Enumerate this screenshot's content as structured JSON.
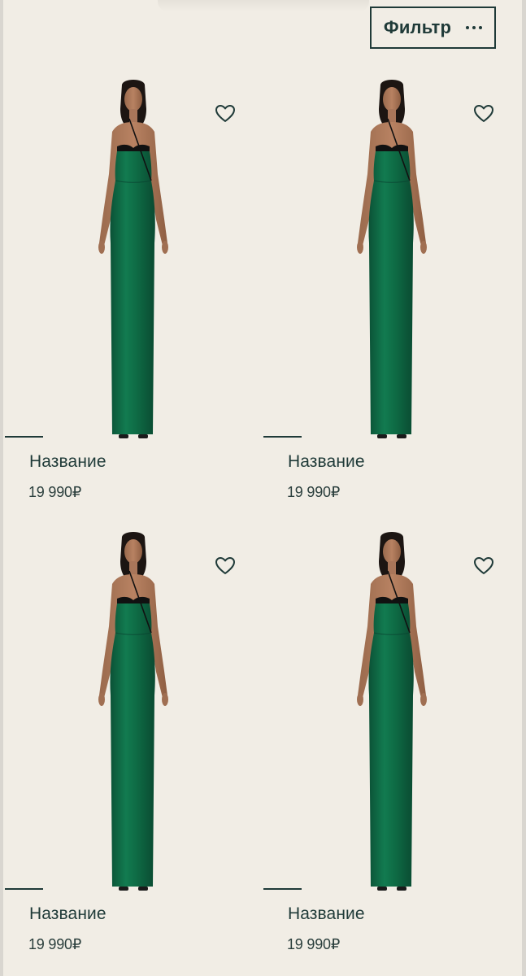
{
  "header": {
    "filter_label": "Фильтр",
    "more_icon": "more-dots-icon"
  },
  "colors": {
    "background": "#f1ede5",
    "accent": "#1f3a38",
    "dress": "#0f6b45"
  },
  "products": [
    {
      "name": "Название",
      "price": "19 990₽",
      "favorite_icon": "heart-outline-icon"
    },
    {
      "name": "Название",
      "price": "19 990₽",
      "favorite_icon": "heart-outline-icon"
    },
    {
      "name": "Название",
      "price": "19 990₽",
      "favorite_icon": "heart-outline-icon"
    },
    {
      "name": "Название",
      "price": "19 990₽",
      "favorite_icon": "heart-outline-icon"
    }
  ]
}
